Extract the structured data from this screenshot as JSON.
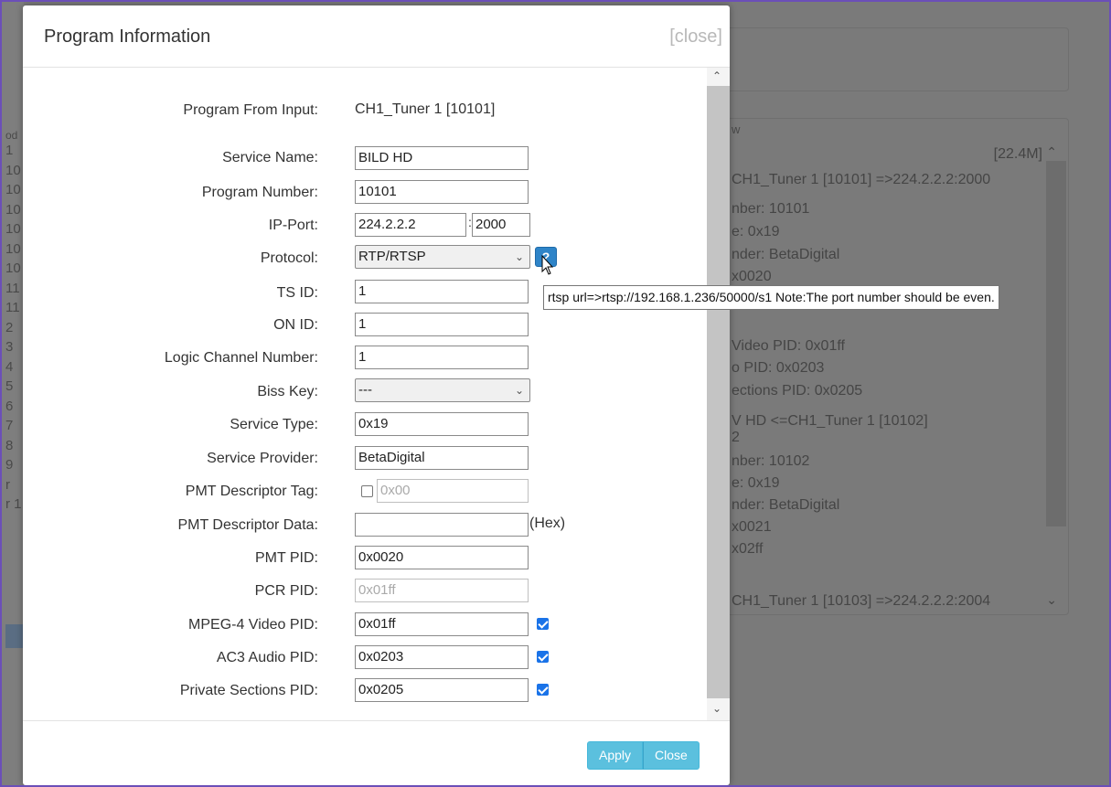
{
  "background": {
    "left_fragments": [
      "od",
      "1",
      "10",
      "10",
      "10",
      "10",
      "10",
      "10",
      "11",
      "11",
      "2",
      "3",
      "4",
      "5",
      "6",
      "7",
      "8",
      "9",
      "r",
      "r 1"
    ],
    "right_panel": {
      "title_fragment": "w",
      "size": "[22.4M]",
      "lines": [
        "CH1_Tuner 1 [10101] =>224.2.2.2:2000",
        "nber: 10101",
        "e: 0x19",
        "nder: BetaDigital",
        "x0020",
        "Video PID: 0x01ff",
        "o PID: 0x0203",
        "ections PID: 0x0205",
        "V HD <=CH1_Tuner 1 [10102]",
        "2",
        "nber: 10102",
        "e: 0x19",
        "nder: BetaDigital",
        "x0021",
        "x02ff",
        "CH1_Tuner 1 [10103] =>224.2.2.2:2004"
      ]
    }
  },
  "modal": {
    "title": "Program Information",
    "close_link": "[close]",
    "fields": {
      "program_from_input": {
        "label": "Program From Input:",
        "value": "CH1_Tuner 1 [10101]"
      },
      "service_name": {
        "label": "Service Name:",
        "value": "BILD HD"
      },
      "program_number": {
        "label": "Program Number:",
        "value": "10101"
      },
      "ip_port": {
        "label": "IP-Port:",
        "ip": "224.2.2.2",
        "separator": ":",
        "port": "2000"
      },
      "protocol": {
        "label": "Protocol:",
        "value": "RTP/RTSP",
        "help": "?"
      },
      "ts_id": {
        "label": "TS ID:",
        "value": "1"
      },
      "on_id": {
        "label": "ON ID:",
        "value": "1"
      },
      "logic_channel_number": {
        "label": "Logic Channel Number:",
        "value": "1"
      },
      "biss_key": {
        "label": "Biss Key:",
        "value": "---"
      },
      "service_type": {
        "label": "Service Type:",
        "value": "0x19"
      },
      "service_provider": {
        "label": "Service Provider:",
        "value": "BetaDigital"
      },
      "pmt_descriptor_tag": {
        "label": "PMT Descriptor Tag:",
        "placeholder": "0x00",
        "checked": false
      },
      "pmt_descriptor_data": {
        "label": "PMT Descriptor Data:",
        "value": "",
        "suffix": "(Hex)"
      },
      "pmt_pid": {
        "label": "PMT PID:",
        "value": "0x0020"
      },
      "pcr_pid": {
        "label": "PCR PID:",
        "value": "0x01ff"
      },
      "mpeg4_video_pid": {
        "label": "MPEG-4 Video PID:",
        "value": "0x01ff",
        "checked": true
      },
      "ac3_audio_pid": {
        "label": "AC3 Audio PID:",
        "value": "0x0203",
        "checked": true
      },
      "private_sections_pid": {
        "label": "Private Sections PID:",
        "value": "0x0205",
        "checked": true
      }
    },
    "tooltip": "rtsp url=>rtsp://192.168.1.236/50000/s1 Note:The port number should be even.",
    "buttons": {
      "apply": "Apply",
      "close": "Close"
    }
  },
  "colors": {
    "accent": "#5bc0de",
    "checkbox": "#1a73e8",
    "frame": "#6b4fb8"
  }
}
